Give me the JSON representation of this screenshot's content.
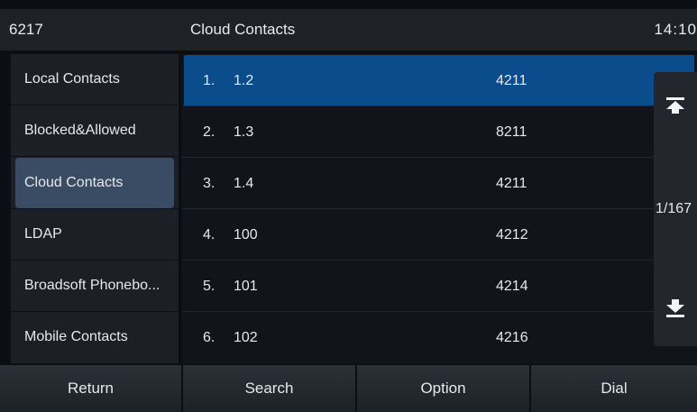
{
  "statusbar": {
    "extension": "6217",
    "title": "Cloud Contacts",
    "time": "14:10"
  },
  "sidebar": {
    "items": [
      {
        "label": "Local Contacts"
      },
      {
        "label": "Blocked&Allowed"
      },
      {
        "label": "Cloud Contacts",
        "active": true
      },
      {
        "label": "LDAP"
      },
      {
        "label": "Broadsoft Phonebo..."
      },
      {
        "label": "Mobile Contacts"
      }
    ]
  },
  "contacts": [
    {
      "num": "1.",
      "name": "1.2",
      "phone": "4211",
      "selected": true
    },
    {
      "num": "2.",
      "name": "1.3",
      "phone": "8211"
    },
    {
      "num": "3.",
      "name": "1.4",
      "phone": "4211"
    },
    {
      "num": "4.",
      "name": "100",
      "phone": "4212"
    },
    {
      "num": "5.",
      "name": "101",
      "phone": "4214"
    },
    {
      "num": "6.",
      "name": "102",
      "phone": "4216"
    }
  ],
  "scroll": {
    "page_indicator": "1/167",
    "top_icon": "scroll-to-top-icon",
    "bottom_icon": "scroll-to-bottom-icon"
  },
  "softkeys": {
    "return": "Return",
    "search": "Search",
    "option": "Option",
    "dial": "Dial"
  },
  "colors": {
    "selected_row": "#0b4d8c",
    "active_sidebar": "#3a4c63",
    "background": "#0b0e13"
  }
}
